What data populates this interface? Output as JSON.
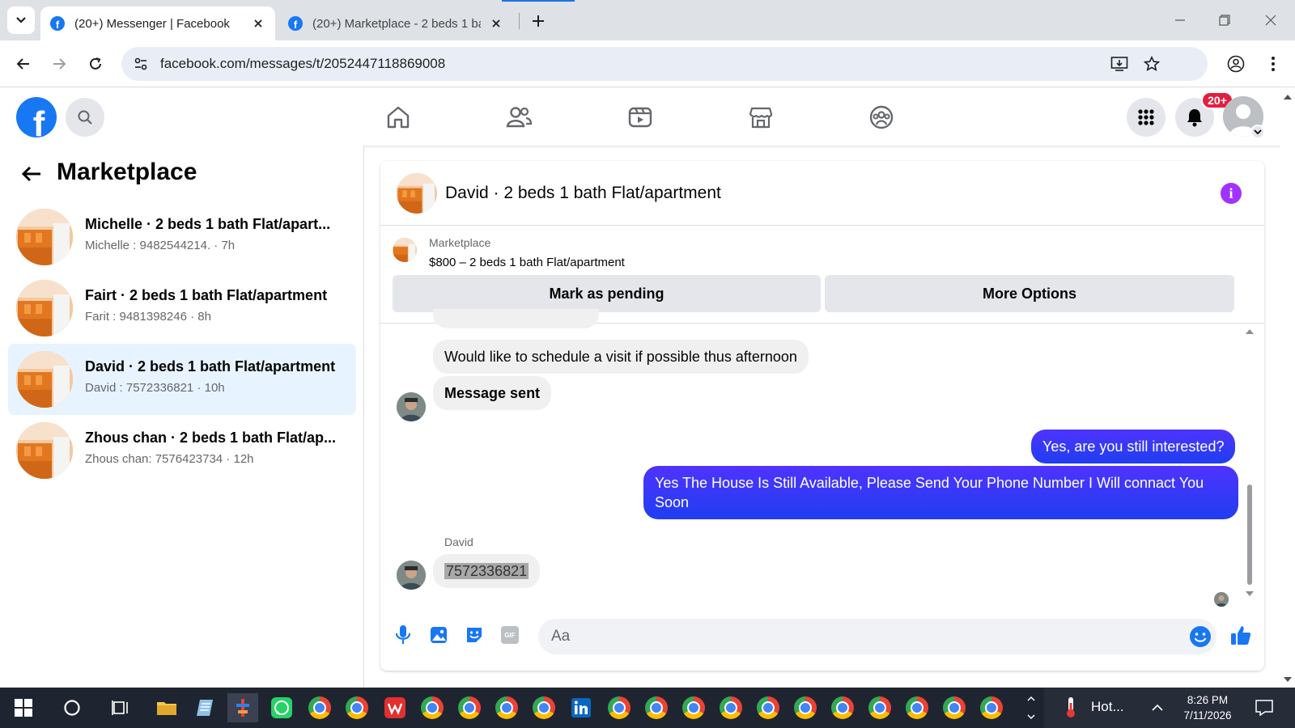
{
  "browser": {
    "tabs": [
      {
        "title": "(20+) Messenger | Facebook",
        "active": true
      },
      {
        "title": "(20+) Marketplace - 2 beds 1 ba",
        "active": false
      }
    ],
    "url": "facebook.com/messages/t/2052447118869008"
  },
  "fb_header": {
    "logo": "f",
    "notification_badge": "20+",
    "nav_icons": [
      "home-icon",
      "friends-icon",
      "watch-icon",
      "marketplace-icon",
      "groups-icon"
    ]
  },
  "left_pane": {
    "title": "Marketplace",
    "conversations": [
      {
        "name": "Michelle · 2 beds 1 bath Flat/apart...",
        "sub": "Michelle : 9482544214. · 7h",
        "selected": false
      },
      {
        "name": "Fairt · 2 beds 1 bath Flat/apartment",
        "sub": "Farit : 9481398246 · 8h",
        "selected": false
      },
      {
        "name": "David · 2 beds 1 bath Flat/apartment",
        "sub": "David : 7572336821 · 10h",
        "selected": true
      },
      {
        "name": "Zhous chan · 2 beds 1 bath Flat/ap...",
        "sub": "Zhous chan: 7576423734 · 12h",
        "selected": false
      }
    ]
  },
  "chat": {
    "title": "David · 2 beds 1 bath Flat/apartment",
    "listing_label": "Marketplace",
    "listing_price": "$800 – 2 beds 1 bath Flat/apartment",
    "mark_pending_label": "Mark as pending",
    "more_options_label": "More Options",
    "messages": {
      "m1": "Would like to schedule a visit if possible thus afternoon",
      "m2": "Message sent",
      "m3": "Yes, are you still interested?",
      "m4": "Yes The House Is Still Available, Please Send Your Phone Number I Will connact You Soon",
      "sender_label": "David",
      "m5": "7572336821"
    },
    "composer_placeholder": "Aa",
    "gif_label": "GIF"
  },
  "taskbar": {
    "time": "8:26 PM",
    "date": "7/11/2026",
    "weather": "Hot..."
  },
  "colors": {
    "fb_blue": "#1877f2",
    "outgoing_bubble": "#2a3ef5",
    "selected_row": "#e7f3ff",
    "badge_red": "#e41e3f",
    "info_purple": "#a033ff"
  }
}
